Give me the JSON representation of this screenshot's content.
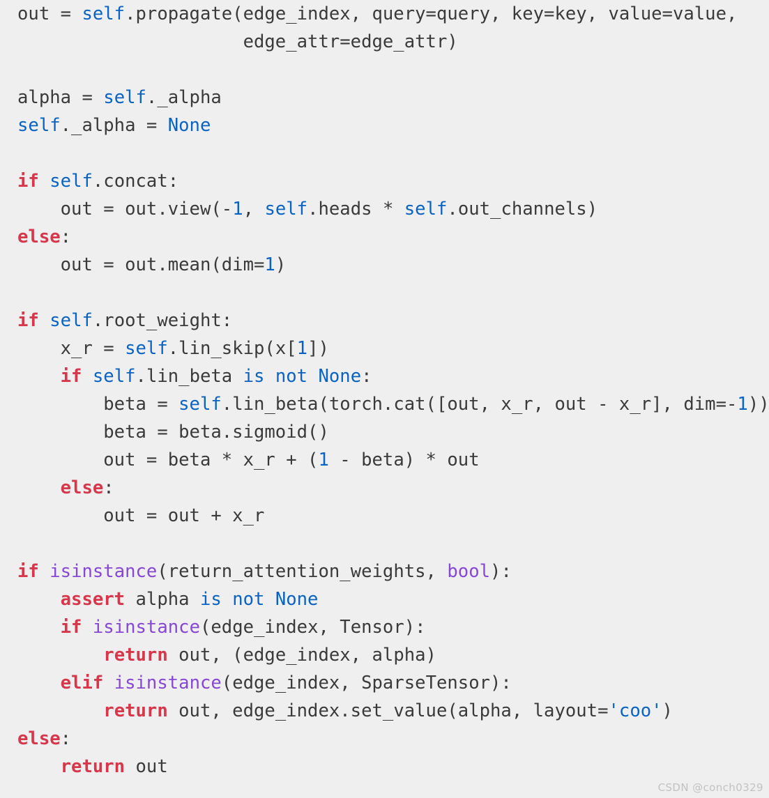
{
  "editor": {
    "language": "python",
    "background_color": "#efefef",
    "default_text_color": "#3a3a3a",
    "keyword_color": "#d8374b",
    "identifier_self_color": "#0a63c2",
    "number_color": "#0a63c2",
    "string_color": "#0a63c2",
    "builtin_color": "#8648d4",
    "font_size_px": 25.6,
    "line_height_px": 40,
    "clipped_right_edge": true
  },
  "code": {
    "lines": [
      {
        "index": 1,
        "text": "out = self.propagate(edge_index, query=query, key=key, value=value,",
        "tokens": [
          {
            "t": "out = ",
            "c": "plain"
          },
          {
            "t": "self",
            "c": "self"
          },
          {
            "t": ".propagate(edge_index, query=query, key=key, value=value,",
            "c": "plain"
          }
        ]
      },
      {
        "index": 2,
        "text": "                     edge_attr=edge_attr)",
        "tokens": [
          {
            "t": "                     edge_attr=edge_attr)",
            "c": "plain"
          }
        ]
      },
      {
        "index": 3,
        "text": "",
        "tokens": []
      },
      {
        "index": 4,
        "text": "alpha = self._alpha",
        "tokens": [
          {
            "t": "alpha = ",
            "c": "plain"
          },
          {
            "t": "self",
            "c": "self"
          },
          {
            "t": "._alpha",
            "c": "plain"
          }
        ]
      },
      {
        "index": 5,
        "text": "self._alpha = None",
        "tokens": [
          {
            "t": "self",
            "c": "self"
          },
          {
            "t": "._alpha = ",
            "c": "plain"
          },
          {
            "t": "None",
            "c": "self"
          }
        ]
      },
      {
        "index": 6,
        "text": "",
        "tokens": []
      },
      {
        "index": 7,
        "text": "if self.concat:",
        "tokens": [
          {
            "t": "if",
            "c": "kw"
          },
          {
            "t": " ",
            "c": "plain"
          },
          {
            "t": "self",
            "c": "self"
          },
          {
            "t": ".concat:",
            "c": "plain"
          }
        ]
      },
      {
        "index": 8,
        "text": "    out = out.view(-1, self.heads * self.out_channels)",
        "tokens": [
          {
            "t": "    out = out.view(-",
            "c": "plain"
          },
          {
            "t": "1",
            "c": "num"
          },
          {
            "t": ", ",
            "c": "plain"
          },
          {
            "t": "self",
            "c": "self"
          },
          {
            "t": ".heads * ",
            "c": "plain"
          },
          {
            "t": "self",
            "c": "self"
          },
          {
            "t": ".out_channels)",
            "c": "plain"
          }
        ]
      },
      {
        "index": 9,
        "text": "else:",
        "tokens": [
          {
            "t": "else",
            "c": "kw"
          },
          {
            "t": ":",
            "c": "plain"
          }
        ]
      },
      {
        "index": 10,
        "text": "    out = out.mean(dim=1)",
        "tokens": [
          {
            "t": "    out = out.mean(dim=",
            "c": "plain"
          },
          {
            "t": "1",
            "c": "num"
          },
          {
            "t": ")",
            "c": "plain"
          }
        ]
      },
      {
        "index": 11,
        "text": "",
        "tokens": []
      },
      {
        "index": 12,
        "text": "if self.root_weight:",
        "tokens": [
          {
            "t": "if",
            "c": "kw"
          },
          {
            "t": " ",
            "c": "plain"
          },
          {
            "t": "self",
            "c": "self"
          },
          {
            "t": ".root_weight:",
            "c": "plain"
          }
        ]
      },
      {
        "index": 13,
        "text": "    x_r = self.lin_skip(x[1])",
        "tokens": [
          {
            "t": "    x_r = ",
            "c": "plain"
          },
          {
            "t": "self",
            "c": "self"
          },
          {
            "t": ".lin_skip(x[",
            "c": "plain"
          },
          {
            "t": "1",
            "c": "num"
          },
          {
            "t": "])",
            "c": "plain"
          }
        ]
      },
      {
        "index": 14,
        "text": "    if self.lin_beta is not None:",
        "tokens": [
          {
            "t": "    ",
            "c": "plain"
          },
          {
            "t": "if",
            "c": "kw"
          },
          {
            "t": " ",
            "c": "plain"
          },
          {
            "t": "self",
            "c": "self"
          },
          {
            "t": ".lin_beta ",
            "c": "plain"
          },
          {
            "t": "is not None",
            "c": "self"
          },
          {
            "t": ":",
            "c": "plain"
          }
        ]
      },
      {
        "index": 15,
        "text": "        beta = self.lin_beta(torch.cat([out, x_r, out - x_r], dim=-1))",
        "tokens": [
          {
            "t": "        beta = ",
            "c": "plain"
          },
          {
            "t": "self",
            "c": "self"
          },
          {
            "t": ".lin_beta(torch.cat([out, x_r, out - x_r], dim=-",
            "c": "plain"
          },
          {
            "t": "1",
            "c": "num"
          },
          {
            "t": "))",
            "c": "plain"
          }
        ]
      },
      {
        "index": 16,
        "text": "        beta = beta.sigmoid()",
        "tokens": [
          {
            "t": "        beta = beta.sigmoid()",
            "c": "plain"
          }
        ]
      },
      {
        "index": 17,
        "text": "        out = beta * x_r + (1 - beta) * out",
        "tokens": [
          {
            "t": "        out = beta * x_r + (",
            "c": "plain"
          },
          {
            "t": "1",
            "c": "num"
          },
          {
            "t": " - beta) * out",
            "c": "plain"
          }
        ]
      },
      {
        "index": 18,
        "text": "    else:",
        "tokens": [
          {
            "t": "    ",
            "c": "plain"
          },
          {
            "t": "else",
            "c": "kw"
          },
          {
            "t": ":",
            "c": "plain"
          }
        ]
      },
      {
        "index": 19,
        "text": "        out = out + x_r",
        "tokens": [
          {
            "t": "        out = out + x_r",
            "c": "plain"
          }
        ]
      },
      {
        "index": 20,
        "text": "",
        "tokens": []
      },
      {
        "index": 21,
        "text": "if isinstance(return_attention_weights, bool):",
        "tokens": [
          {
            "t": "if",
            "c": "kw"
          },
          {
            "t": " ",
            "c": "plain"
          },
          {
            "t": "isinstance",
            "c": "bi"
          },
          {
            "t": "(return_attention_weights, ",
            "c": "plain"
          },
          {
            "t": "bool",
            "c": "bi"
          },
          {
            "t": "):",
            "c": "plain"
          }
        ]
      },
      {
        "index": 22,
        "text": "    assert alpha is not None",
        "tokens": [
          {
            "t": "    ",
            "c": "plain"
          },
          {
            "t": "assert",
            "c": "kw"
          },
          {
            "t": " alpha ",
            "c": "plain"
          },
          {
            "t": "is not None",
            "c": "self"
          }
        ]
      },
      {
        "index": 23,
        "text": "    if isinstance(edge_index, Tensor):",
        "tokens": [
          {
            "t": "    ",
            "c": "plain"
          },
          {
            "t": "if",
            "c": "kw"
          },
          {
            "t": " ",
            "c": "plain"
          },
          {
            "t": "isinstance",
            "c": "bi"
          },
          {
            "t": "(edge_index, Tensor):",
            "c": "plain"
          }
        ]
      },
      {
        "index": 24,
        "text": "        return out, (edge_index, alpha)",
        "tokens": [
          {
            "t": "        ",
            "c": "plain"
          },
          {
            "t": "return",
            "c": "kw"
          },
          {
            "t": " out, (edge_index, alpha)",
            "c": "plain"
          }
        ]
      },
      {
        "index": 25,
        "text": "    elif isinstance(edge_index, SparseTensor):",
        "tokens": [
          {
            "t": "    ",
            "c": "plain"
          },
          {
            "t": "elif",
            "c": "kw"
          },
          {
            "t": " ",
            "c": "plain"
          },
          {
            "t": "isinstance",
            "c": "bi"
          },
          {
            "t": "(edge_index, SparseTensor):",
            "c": "plain"
          }
        ]
      },
      {
        "index": 26,
        "text": "        return out, edge_index.set_value(alpha, layout='coo')",
        "tokens": [
          {
            "t": "        ",
            "c": "plain"
          },
          {
            "t": "return",
            "c": "kw"
          },
          {
            "t": " out, edge_index.set_value(alpha, layout=",
            "c": "plain"
          },
          {
            "t": "'coo'",
            "c": "str"
          },
          {
            "t": ")",
            "c": "plain"
          }
        ]
      },
      {
        "index": 27,
        "text": "else:",
        "tokens": [
          {
            "t": "else",
            "c": "kw"
          },
          {
            "t": ":",
            "c": "plain"
          }
        ]
      },
      {
        "index": 28,
        "text": "    return out",
        "tokens": [
          {
            "t": "    ",
            "c": "plain"
          },
          {
            "t": "return",
            "c": "kw"
          },
          {
            "t": " out",
            "c": "plain"
          }
        ]
      }
    ]
  },
  "watermark": {
    "text": "CSDN @conch0329"
  }
}
